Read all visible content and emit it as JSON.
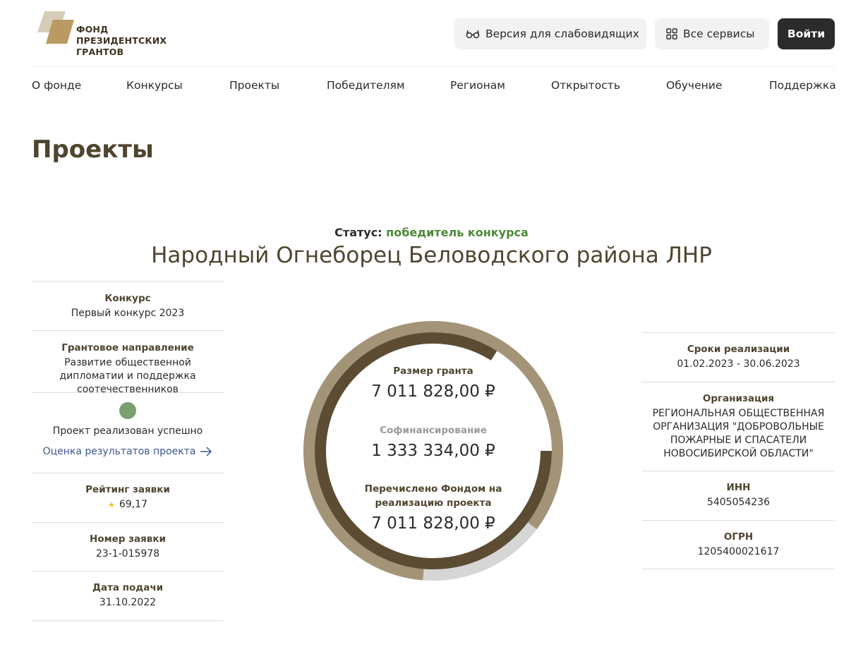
{
  "header": {
    "logo_lines": [
      "ФОНД",
      "ПРЕЗИДЕНТСКИХ",
      "ГРАНТОВ"
    ],
    "low_vision_label": "Версия для слабовидящих",
    "all_services_label": "Все сервисы",
    "login_label": "Войти"
  },
  "nav": [
    "О фонде",
    "Конкурсы",
    "Проекты",
    "Победителям",
    "Регионам",
    "Открытость",
    "Обучение",
    "Поддержка"
  ],
  "page_title": "Проекты",
  "status": {
    "label": "Статус:",
    "value": "победитель конкурса"
  },
  "project_title": "Народный Огнеборец Беловодского района ЛНР",
  "left": {
    "contest_label": "Конкурс",
    "contest_value": "Первый конкурс 2023",
    "direction_label": "Грантовое направление",
    "direction_value": "Развитие общественной дипломатии и поддержка соотечественников",
    "result_text": "Проект реализован успешно",
    "evaluation_link": "Оценка результатов проекта",
    "rating_label": "Рейтинг заявки",
    "rating_value": "69,17",
    "number_label": "Номер заявки",
    "number_value": "23-1-015978",
    "date_label": "Дата подачи",
    "date_value": "31.10.2022"
  },
  "center": {
    "grant_label": "Размер гранта",
    "grant_value": "7 011 828,00 ₽",
    "cofin_label": "Софинансирование",
    "cofin_value": "1 333 334,00 ₽",
    "transferred_label": "Перечислено Фондом на реализацию проекта",
    "transferred_value": "7 011 828,00 ₽",
    "transferred_fraction": 0.84,
    "grant_fraction": 0.84,
    "colors": {
      "outer": "#a39478",
      "inner": "#5b4c33",
      "rest": "#d6d6d6",
      "status": "#4e8a38",
      "dot": "#79a06f"
    }
  },
  "right": {
    "period_label": "Сроки реализации",
    "period_value": "01.02.2023 - 30.06.2023",
    "org_label": "Организация",
    "org_value": "РЕГИОНАЛЬНАЯ ОБЩЕСТВЕННАЯ ОРГАНИЗАЦИЯ \"ДОБРОВОЛЬНЫЕ ПОЖАРНЫЕ И СПАСАТЕЛИ НОВОСИБИРСКОЙ ОБЛАСТИ\"",
    "inn_label": "ИНН",
    "inn_value": "5405054236",
    "ogrn_label": "ОГРН",
    "ogrn_value": "1205400021617"
  }
}
